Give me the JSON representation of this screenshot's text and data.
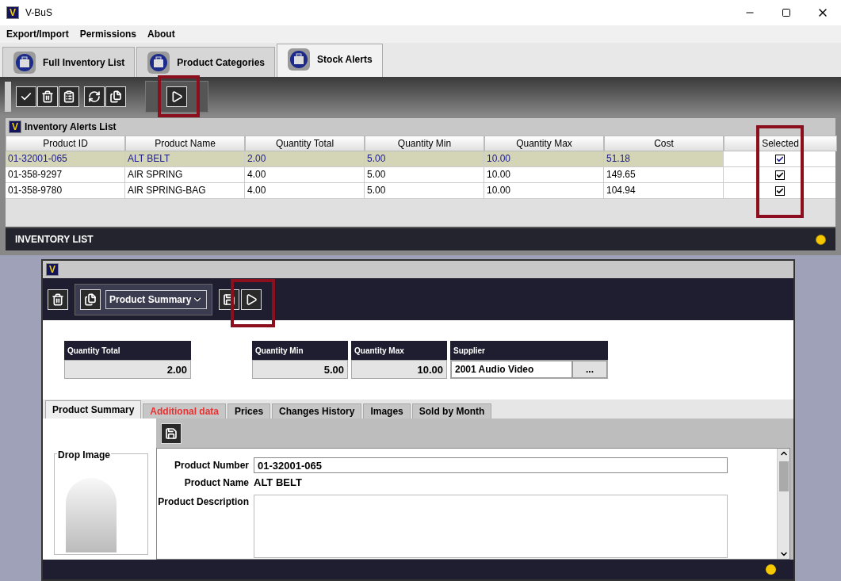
{
  "window": {
    "logo": "V",
    "title": "V-BuS"
  },
  "menu": [
    "Export/Import",
    "Permissions",
    "About"
  ],
  "tabs": [
    {
      "label": "Full Inventory List",
      "selected": false
    },
    {
      "label": "Product Categories",
      "selected": false
    },
    {
      "label": "Stock Alerts",
      "selected": true
    }
  ],
  "alerts_list": {
    "logo": "V",
    "title": "Inventory Alerts List",
    "columns": [
      "Product ID",
      "Product Name",
      "Quantity Total",
      "Quantity Min",
      "Quantity Max",
      "Cost",
      "Selected"
    ],
    "rows": [
      {
        "selected": true,
        "cells": [
          "01-32001-065",
          "ALT BELT",
          "2.00",
          "5.00",
          "10.00",
          "51.18"
        ],
        "checked": true
      },
      {
        "selected": false,
        "cells": [
          "01-358-9297",
          "AIR SPRING",
          "4.00",
          "5.00",
          "10.00",
          "149.65"
        ],
        "checked": true
      },
      {
        "selected": false,
        "cells": [
          "01-358-9780",
          "AIR SPRING-BAG",
          "4.00",
          "5.00",
          "10.00",
          "104.94"
        ],
        "checked": true
      }
    ],
    "footer": "INVENTORY LIST"
  },
  "detail": {
    "logo": "V",
    "view_select": "Product Summary",
    "quantity_total": {
      "label": "Quantity Total",
      "value": "2.00"
    },
    "quantity_min": {
      "label": "Quantity Min",
      "value": "5.00"
    },
    "quantity_max": {
      "label": "Quantity Max",
      "value": "10.00"
    },
    "supplier": {
      "label": "Supplier",
      "value": "2001 Audio Video",
      "button": "..."
    },
    "tabs": [
      {
        "label": "Product Summary",
        "selected": true,
        "alert": false
      },
      {
        "label": "Additional data",
        "selected": false,
        "alert": true
      },
      {
        "label": "Prices",
        "selected": false,
        "alert": false
      },
      {
        "label": "Changes History",
        "selected": false,
        "alert": false
      },
      {
        "label": "Images",
        "selected": false,
        "alert": false
      },
      {
        "label": "Sold by Month",
        "selected": false,
        "alert": false
      }
    ],
    "drop_image": "Drop Image",
    "form": [
      {
        "kind": "input",
        "label": "Product Number",
        "value": "01-32001-065"
      },
      {
        "kind": "text",
        "label": "Product Name",
        "value": "ALT BELT"
      },
      {
        "kind": "textarea",
        "label": "Product Description"
      }
    ]
  }
}
